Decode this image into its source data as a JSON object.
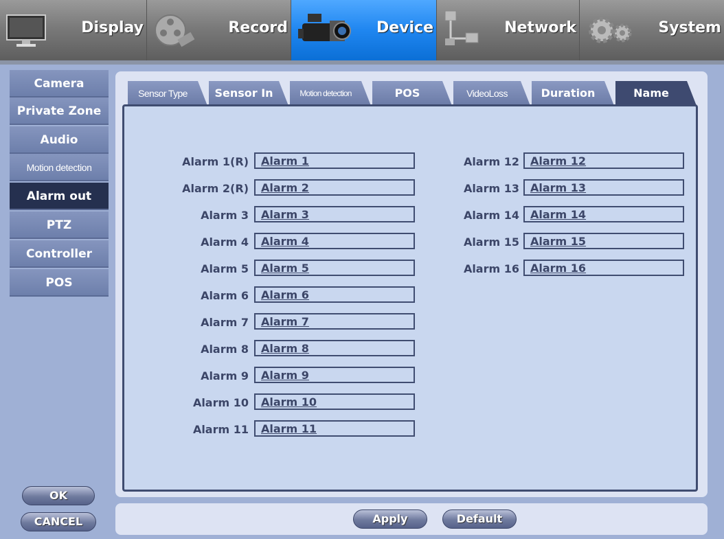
{
  "top_menu": [
    {
      "label": "Display",
      "icon": "monitor-icon"
    },
    {
      "label": "Record",
      "icon": "film-reel-icon"
    },
    {
      "label": "Device",
      "icon": "camcorder-icon",
      "active": true
    },
    {
      "label": "Network",
      "icon": "network-icon"
    },
    {
      "label": "System",
      "icon": "gears-icon"
    }
  ],
  "sidebar": [
    {
      "label": "Camera"
    },
    {
      "label": "Private Zone"
    },
    {
      "label": "Audio"
    },
    {
      "label": "Motion detection"
    },
    {
      "label": "Alarm out",
      "active": true
    },
    {
      "label": "PTZ"
    },
    {
      "label": "Controller"
    },
    {
      "label": "POS"
    }
  ],
  "tabs": [
    {
      "label": "Sensor Type"
    },
    {
      "label": "Sensor In"
    },
    {
      "label": "Motion detection"
    },
    {
      "label": "POS"
    },
    {
      "label": "VideoLoss"
    },
    {
      "label": "Duration"
    },
    {
      "label": "Name",
      "active": true
    }
  ],
  "alarms": [
    {
      "label": "Alarm 1(R)",
      "value": "Alarm 1"
    },
    {
      "label": "Alarm 2(R)",
      "value": "Alarm 2"
    },
    {
      "label": "Alarm 3",
      "value": "Alarm 3"
    },
    {
      "label": "Alarm 4",
      "value": "Alarm 4"
    },
    {
      "label": "Alarm 5",
      "value": "Alarm 5"
    },
    {
      "label": "Alarm 6",
      "value": "Alarm 6"
    },
    {
      "label": "Alarm 7",
      "value": "Alarm 7"
    },
    {
      "label": "Alarm 8",
      "value": "Alarm 8"
    },
    {
      "label": "Alarm 9",
      "value": "Alarm 9"
    },
    {
      "label": "Alarm 10",
      "value": "Alarm 10"
    },
    {
      "label": "Alarm 11",
      "value": "Alarm 11"
    },
    {
      "label": "Alarm 12",
      "value": "Alarm 12"
    },
    {
      "label": "Alarm 13",
      "value": "Alarm 13"
    },
    {
      "label": "Alarm 14",
      "value": "Alarm 14"
    },
    {
      "label": "Alarm 15",
      "value": "Alarm 15"
    },
    {
      "label": "Alarm 16",
      "value": "Alarm 16"
    }
  ],
  "buttons": {
    "ok": "OK",
    "cancel": "CANCEL",
    "apply": "Apply",
    "default": "Default"
  },
  "colors": {
    "accent": "#1f86f0",
    "active_side": "#25304f",
    "content_bg": "#c9d7ef",
    "text": "#3c4668"
  }
}
